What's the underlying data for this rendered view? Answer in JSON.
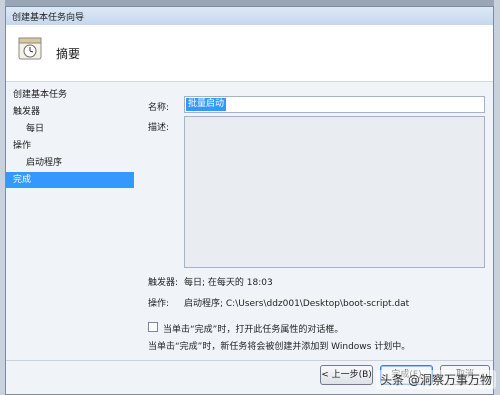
{
  "window": {
    "title": "创建基本任务向导"
  },
  "header": {
    "title": "摘要"
  },
  "steps": [
    {
      "label": "创建基本任务"
    },
    {
      "label": "触发器"
    },
    {
      "label": "每日"
    },
    {
      "label": "操作"
    },
    {
      "label": "启动程序"
    },
    {
      "label": "完成"
    }
  ],
  "form": {
    "name_label": "名称:",
    "name_value": "批量启动",
    "desc_label": "描述:"
  },
  "summary": {
    "trigger_label": "触发器:",
    "trigger_value": "每日; 在每天的 18:03",
    "action_label": "操作:",
    "action_value": "启动程序; C:\\Users\\ddz001\\Desktop\\boot-script.dat"
  },
  "options": {
    "open_properties_label": "当单击“完成”时，打开此任务属性的对话框。",
    "note": "当单击“完成”时，新任务将会被创建并添加到 Windows 计划中。"
  },
  "buttons": {
    "back": "< 上一步(B)",
    "finish": "完成(F)",
    "cancel": "取消"
  },
  "watermark": "头条 @洞察万事万物"
}
